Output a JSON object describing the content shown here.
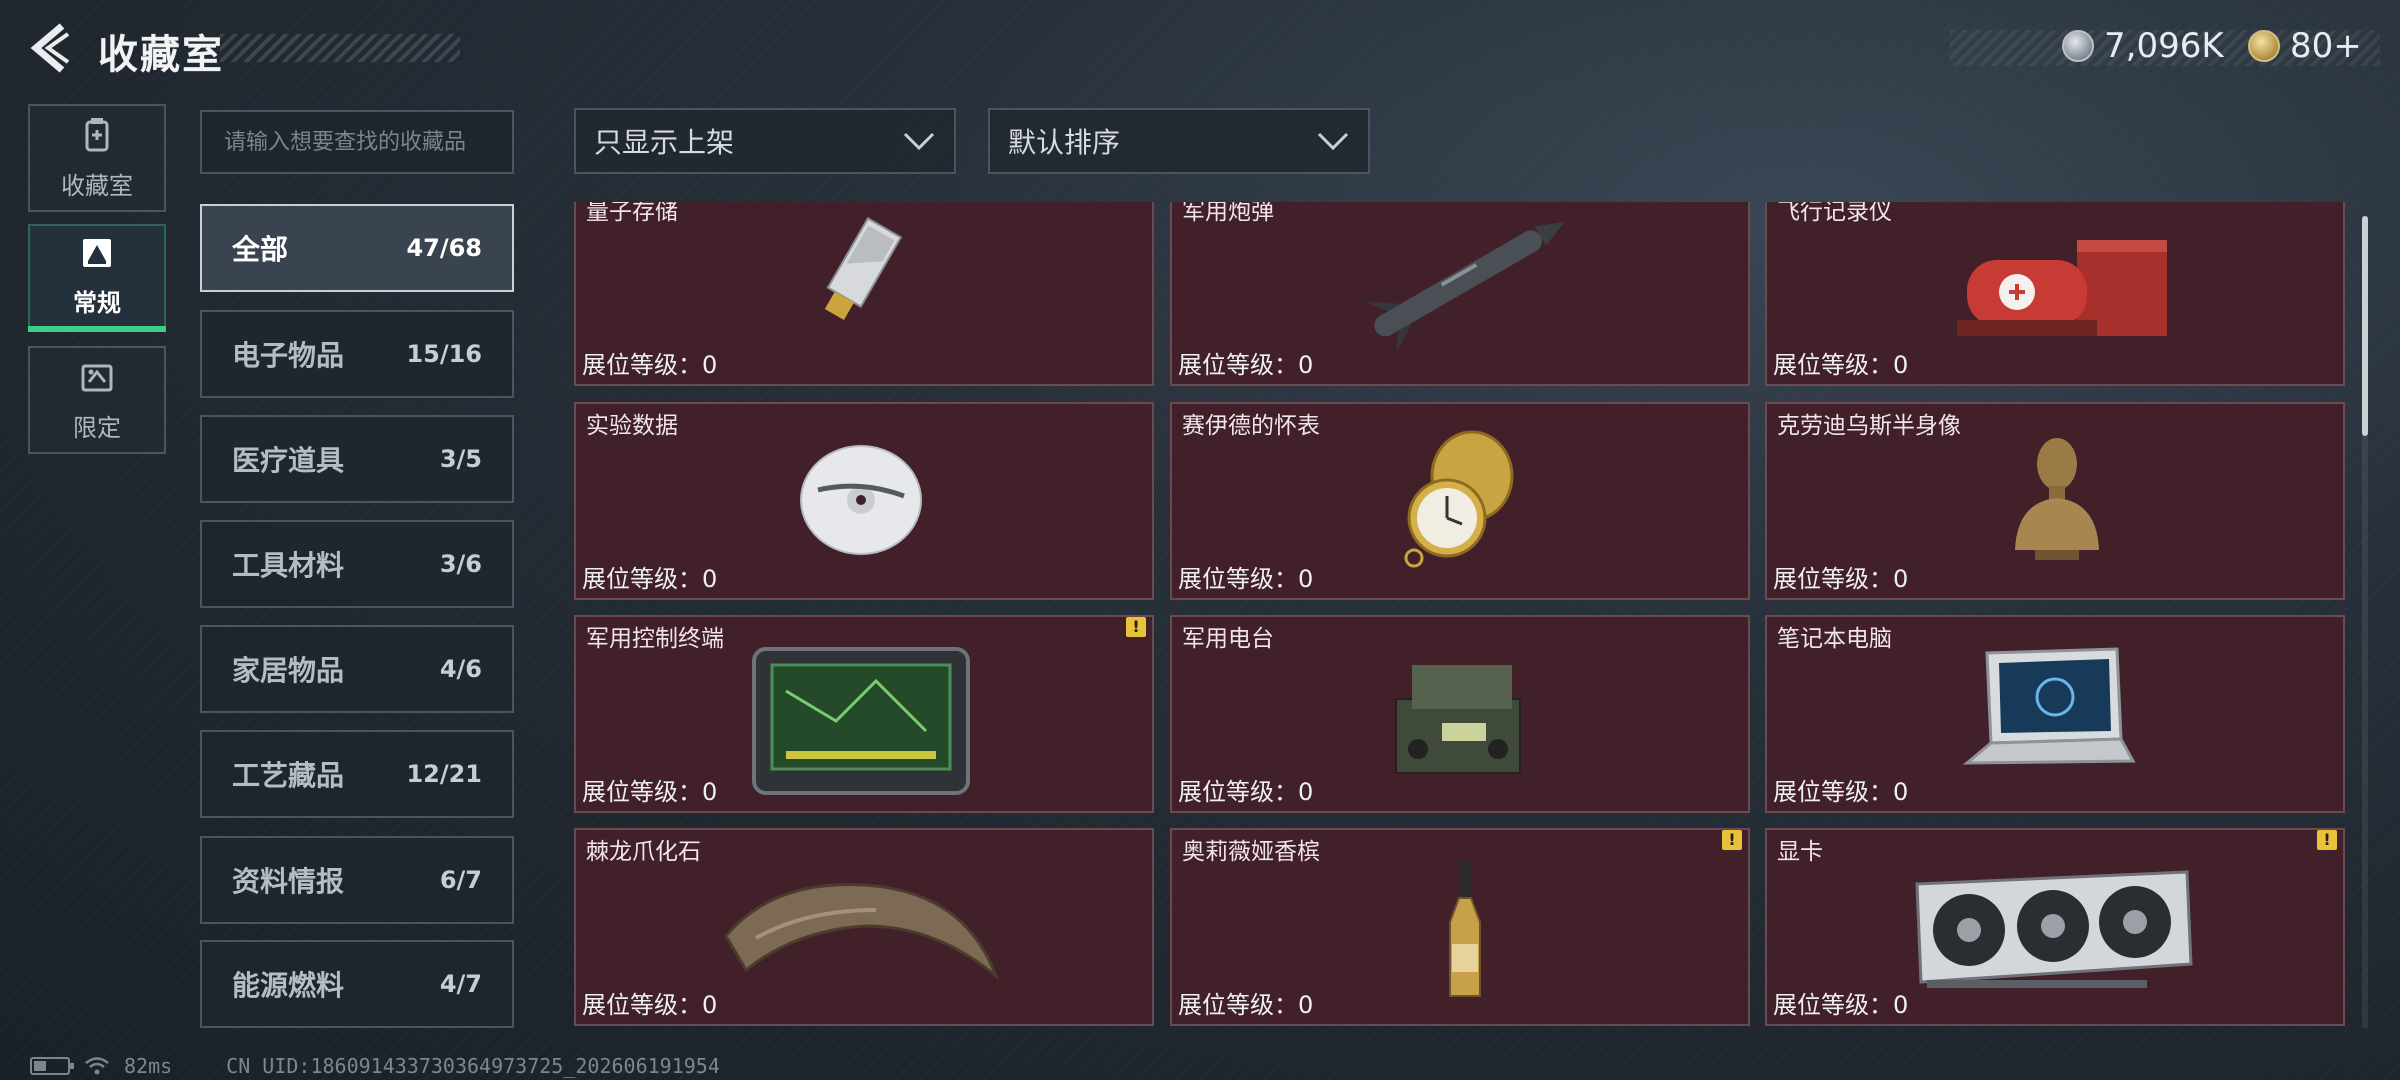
{
  "header": {
    "title": "收藏室",
    "currency": [
      {
        "icon": "silver-coin-icon",
        "value": "7,096K"
      },
      {
        "icon": "gold-coin-icon",
        "value": "80+"
      }
    ]
  },
  "side_tabs": [
    {
      "label": "收藏室",
      "icon": "collection-room-icon",
      "active": false
    },
    {
      "label": "常规",
      "icon": "regular-icon",
      "active": true
    },
    {
      "label": "限定",
      "icon": "limited-icon",
      "active": false
    }
  ],
  "search": {
    "placeholder": "请输入想要查找的收藏品",
    "value": ""
  },
  "filters": {
    "display_filter": "只显示上架",
    "sort_order": "默认排序"
  },
  "categories": [
    {
      "name": "全部",
      "count": "47/68",
      "active": true
    },
    {
      "name": "电子物品",
      "count": "15/16"
    },
    {
      "name": "医疗道具",
      "count": "3/5"
    },
    {
      "name": "工具材料",
      "count": "3/6"
    },
    {
      "name": "家居物品",
      "count": "4/6"
    },
    {
      "name": "工艺藏品",
      "count": "12/21"
    },
    {
      "name": "资料情报",
      "count": "6/7"
    },
    {
      "name": "能源燃料",
      "count": "4/7"
    }
  ],
  "level_label": "展位等级：0",
  "items": [
    {
      "name": "量子存储",
      "icon": "usb-drive-icon",
      "alert": false
    },
    {
      "name": "军用炮弹",
      "icon": "missile-icon",
      "alert": false
    },
    {
      "name": "飞行记录仪",
      "icon": "flight-recorder-icon",
      "alert": false
    },
    {
      "name": "实验数据",
      "icon": "disc-icon",
      "alert": false
    },
    {
      "name": "赛伊德的怀表",
      "icon": "pocket-watch-icon",
      "alert": false
    },
    {
      "name": "克劳迪乌斯半身像",
      "icon": "bust-icon",
      "alert": false
    },
    {
      "name": "军用控制终端",
      "icon": "control-terminal-icon",
      "alert": true
    },
    {
      "name": "军用电台",
      "icon": "radio-icon",
      "alert": false
    },
    {
      "name": "笔记本电脑",
      "icon": "laptop-icon",
      "alert": false
    },
    {
      "name": "棘龙爪化石",
      "icon": "claw-fossil-icon",
      "alert": false
    },
    {
      "name": "奥莉薇娅香槟",
      "icon": "champagne-icon",
      "alert": true
    },
    {
      "name": "显卡",
      "icon": "graphics-card-icon",
      "alert": true
    }
  ],
  "alert_mark": "!",
  "footer": {
    "latency": "82ms",
    "uid": "CN UID:186091433730364973725_202606191954"
  },
  "colors": {
    "accent_green": "#3ccf86",
    "card_bg": "#42202a",
    "alert_yellow": "#e8c23a"
  }
}
